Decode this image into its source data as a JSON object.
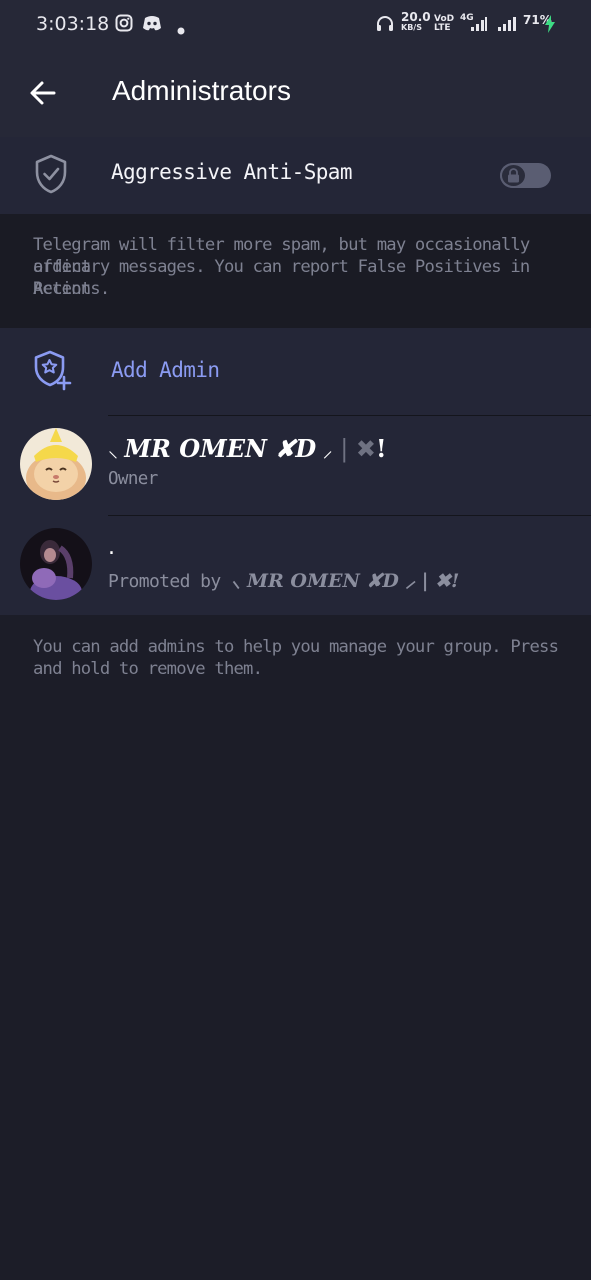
{
  "status_bar": {
    "time": "3:03:18",
    "net_speed": "20.0",
    "net_unit": "KB/S",
    "volte": "VoD",
    "lte": "LTE",
    "signal_label": "4G",
    "battery": "71%",
    "icons": [
      "instagram-icon",
      "discord-icon",
      "dot-icon",
      "headphones-icon",
      "signal-icon",
      "signal-icon",
      "charging-icon"
    ]
  },
  "appbar": {
    "title": "Administrators"
  },
  "anti_spam": {
    "label": "Aggressive Anti-Spam",
    "enabled": false,
    "locked": true,
    "info_lines": [
      "Telegram will filter more spam, but may occasionally affect",
      "ordinary messages. You can report False Positives in Recent",
      "Actions."
    ]
  },
  "add_admin": {
    "label": "Add Admin"
  },
  "admins": [
    {
      "name_prefix": "⸜ ",
      "name_main": "MR OMEN ✘D",
      "name_suffix": " ⸝",
      "name_tail": " | ",
      "name_x": "✖",
      "name_end": "!",
      "role": "Owner"
    },
    {
      "name": ".",
      "promoted_prefix": "Promoted by ",
      "promoted_by": "⸜ MR OMEN ✘D ⸝ | ✖!"
    }
  ],
  "footer_info_lines": [
    "You can add admins to help you manage your group. Press",
    "and hold to remove them."
  ],
  "colors": {
    "background": "#1c1d28",
    "surface": "#242637",
    "accent": "#8b9bf2",
    "charging": "#3ddc84"
  }
}
